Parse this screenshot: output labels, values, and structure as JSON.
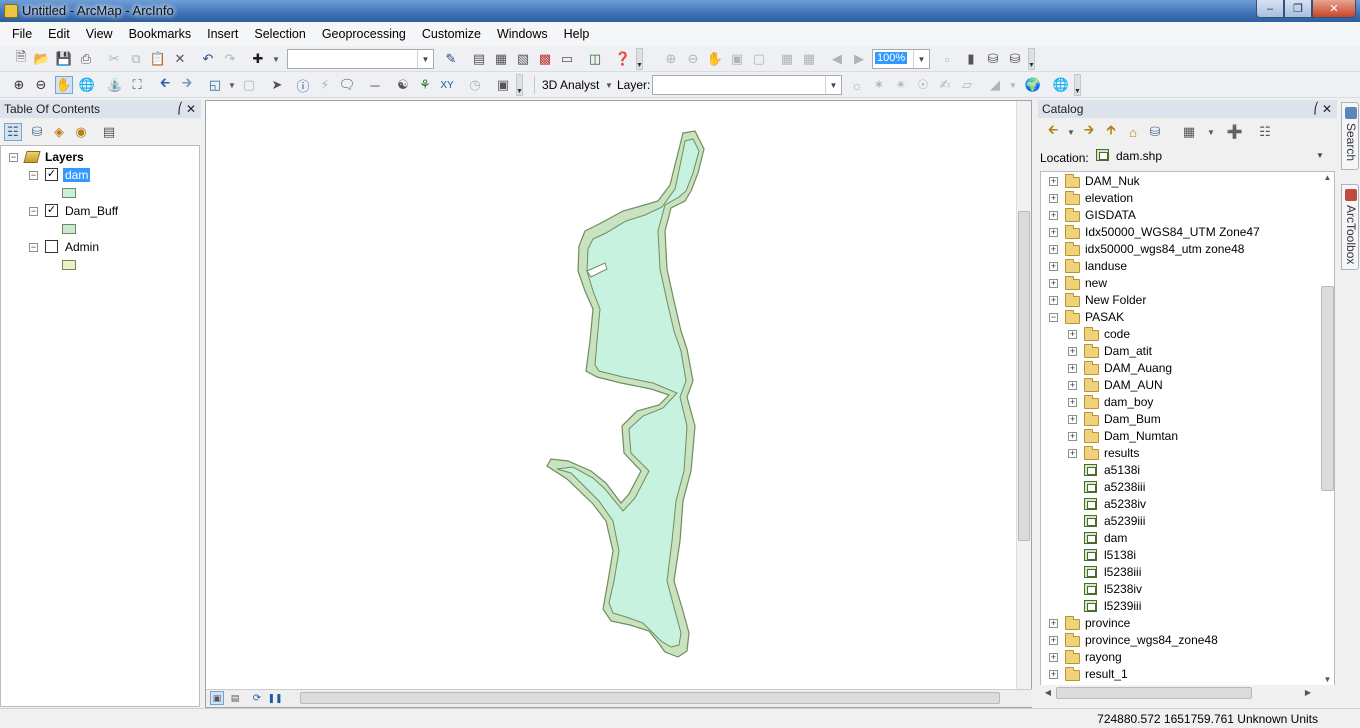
{
  "window": {
    "title": "Untitled - ArcMap - ArcInfo"
  },
  "menu": [
    "File",
    "Edit",
    "View",
    "Bookmarks",
    "Insert",
    "Selection",
    "Geoprocessing",
    "Customize",
    "Windows",
    "Help"
  ],
  "toolbar": {
    "scale_value": "100%",
    "analyst_label": "3D Analyst",
    "layer_label": "Layer:",
    "layer_value": ""
  },
  "toc": {
    "title": "Table Of Contents",
    "root": "Layers",
    "layers": [
      {
        "name": "dam",
        "checked": true,
        "selected": true,
        "color": "#c7f0dd"
      },
      {
        "name": "Dam_Buff",
        "checked": true,
        "selected": false,
        "color": "#cde8cf"
      },
      {
        "name": "Admin",
        "checked": false,
        "selected": false,
        "color": "#f0f0c8"
      }
    ]
  },
  "map": {
    "fill": "#c8f2e0",
    "buffer": "#c9e2c0",
    "outline": "#6f8d5d"
  },
  "catalog": {
    "title": "Catalog",
    "location_label": "Location:",
    "location_value": "dam.shp",
    "items": [
      {
        "label": "DAM_Nuk",
        "type": "folder",
        "level": 0,
        "expandable": true
      },
      {
        "label": "elevation",
        "type": "folder",
        "level": 0,
        "expandable": true
      },
      {
        "label": "GISDATA",
        "type": "folder",
        "level": 0,
        "expandable": true
      },
      {
        "label": "Idx50000_WGS84_UTM Zone47",
        "type": "folder",
        "level": 0,
        "expandable": true
      },
      {
        "label": "idx50000_wgs84_utm zone48",
        "type": "folder",
        "level": 0,
        "expandable": true
      },
      {
        "label": "landuse",
        "type": "folder",
        "level": 0,
        "expandable": true
      },
      {
        "label": "new",
        "type": "folder",
        "level": 0,
        "expandable": true
      },
      {
        "label": "New Folder",
        "type": "folder",
        "level": 0,
        "expandable": true
      },
      {
        "label": "PASAK",
        "type": "folder",
        "level": 0,
        "expandable": true,
        "expanded": true
      },
      {
        "label": "code",
        "type": "folder",
        "level": 1,
        "expandable": true
      },
      {
        "label": "Dam_atit",
        "type": "folder",
        "level": 1,
        "expandable": true
      },
      {
        "label": "DAM_Auang",
        "type": "folder",
        "level": 1,
        "expandable": true
      },
      {
        "label": "DAM_AUN",
        "type": "folder",
        "level": 1,
        "expandable": true
      },
      {
        "label": "dam_boy",
        "type": "folder",
        "level": 1,
        "expandable": true
      },
      {
        "label": "Dam_Bum",
        "type": "folder",
        "level": 1,
        "expandable": true
      },
      {
        "label": "Dam_Numtan",
        "type": "folder",
        "level": 1,
        "expandable": true
      },
      {
        "label": "results",
        "type": "folder",
        "level": 1,
        "expandable": true
      },
      {
        "label": "a5138i",
        "type": "shp",
        "level": 1
      },
      {
        "label": "a5238iii",
        "type": "shp",
        "level": 1
      },
      {
        "label": "a5238iv",
        "type": "shp",
        "level": 1
      },
      {
        "label": "a5239iii",
        "type": "shp",
        "level": 1
      },
      {
        "label": "dam",
        "type": "shp",
        "level": 1
      },
      {
        "label": "l5138i",
        "type": "shp",
        "level": 1
      },
      {
        "label": "l5238iii",
        "type": "shp",
        "level": 1
      },
      {
        "label": "l5238iv",
        "type": "shp",
        "level": 1
      },
      {
        "label": "l5239iii",
        "type": "shp",
        "level": 1
      },
      {
        "label": "province",
        "type": "folder",
        "level": 0,
        "expandable": true
      },
      {
        "label": "province_wgs84_zone48",
        "type": "folder",
        "level": 0,
        "expandable": true
      },
      {
        "label": "rayong",
        "type": "folder",
        "level": 0,
        "expandable": true
      },
      {
        "label": "result_1",
        "type": "folder",
        "level": 0,
        "expandable": true
      }
    ]
  },
  "sidetabs": [
    "Search",
    "ArcToolbox"
  ],
  "status": {
    "coords": "724880.572  1651759.761 Unknown Units"
  }
}
